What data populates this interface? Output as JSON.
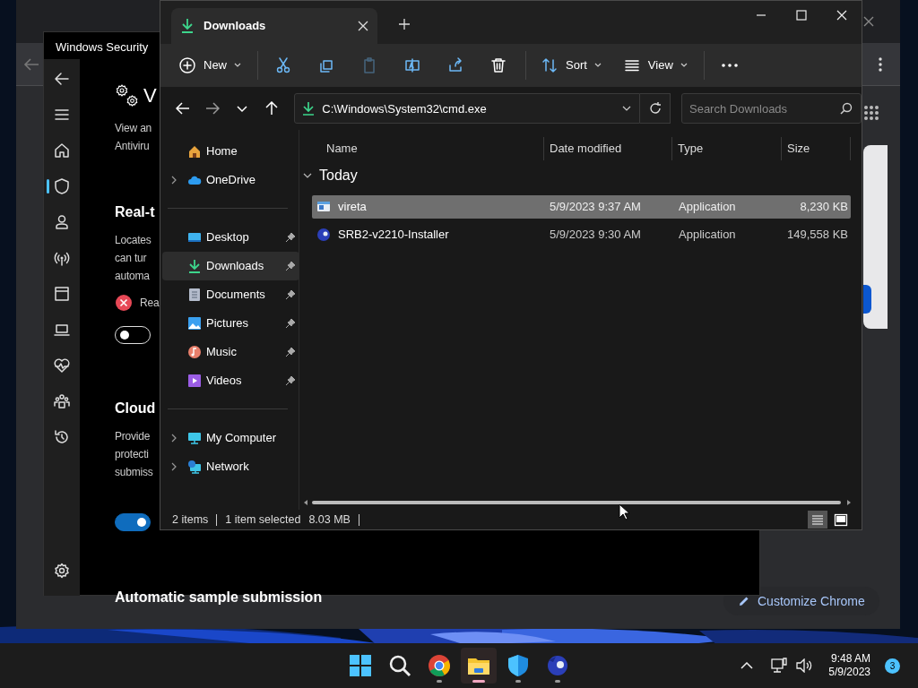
{
  "chrome_window": {
    "customize_button": "Customize Chrome"
  },
  "security_window": {
    "title": "Windows Security",
    "nav": [
      {
        "kind": "back",
        "selected": false
      },
      {
        "kind": "menu",
        "selected": false
      },
      {
        "kind": "home",
        "selected": false
      },
      {
        "kind": "shield",
        "selected": true
      },
      {
        "kind": "person",
        "selected": false
      },
      {
        "kind": "antenna",
        "selected": false
      },
      {
        "kind": "window",
        "selected": false
      },
      {
        "kind": "laptop",
        "selected": false
      },
      {
        "kind": "heart",
        "selected": false
      },
      {
        "kind": "family",
        "selected": false
      },
      {
        "kind": "history",
        "selected": false
      },
      {
        "kind": "settings",
        "selected": false
      }
    ],
    "heading": "V",
    "intro": [
      "View an",
      "Antiviru"
    ],
    "sections": [
      {
        "title": "Real-t",
        "description": [
          "Locates",
          "can tur",
          "automa"
        ],
        "status": {
          "kind": "error",
          "label": "Rea"
        },
        "toggle": {
          "on": false
        }
      },
      {
        "title": "Cloud",
        "description": [
          "Provide",
          "protecti",
          "submiss"
        ],
        "toggle": {
          "on": true
        }
      },
      {
        "title": "Automatic sample submission"
      }
    ]
  },
  "explorer_window": {
    "tabs": [
      {
        "label": "Downloads",
        "selected": true
      }
    ],
    "toolbar": [
      {
        "kind": "new",
        "label": "New",
        "disabled": false
      },
      {
        "kind": "cut",
        "disabled": false
      },
      {
        "kind": "copy",
        "disabled": false
      },
      {
        "kind": "paste",
        "disabled": true
      },
      {
        "kind": "rename",
        "disabled": false
      },
      {
        "kind": "share",
        "disabled": false
      },
      {
        "kind": "delete",
        "disabled": false
      },
      {
        "kind": "sort",
        "label": "Sort",
        "disabled": false
      },
      {
        "kind": "view",
        "label": "View",
        "disabled": false
      },
      {
        "kind": "more",
        "disabled": false
      }
    ],
    "address": "C:\\Windows\\System32\\cmd.exe",
    "search": {
      "placeholder": "Search Downloads"
    },
    "nav_pane": [
      [
        {
          "kind": "home",
          "label": "Home",
          "expandable": false,
          "pinned": false,
          "selected": false
        },
        {
          "kind": "cloud",
          "label": "OneDrive",
          "expandable": true,
          "pinned": false,
          "selected": false
        }
      ],
      [
        {
          "kind": "desktop",
          "label": "Desktop",
          "expandable": false,
          "pinned": true,
          "selected": false
        },
        {
          "kind": "downloads",
          "label": "Downloads",
          "expandable": false,
          "pinned": true,
          "selected": true
        },
        {
          "kind": "documents",
          "label": "Documents",
          "expandable": false,
          "pinned": true,
          "selected": false
        },
        {
          "kind": "pictures",
          "label": "Pictures",
          "expandable": false,
          "pinned": true,
          "selected": false
        },
        {
          "kind": "music",
          "label": "Music",
          "expandable": false,
          "pinned": true,
          "selected": false
        },
        {
          "kind": "videos",
          "label": "Videos",
          "expandable": false,
          "pinned": true,
          "selected": false
        }
      ],
      [
        {
          "kind": "computer",
          "label": "My Computer",
          "expandable": true,
          "pinned": false,
          "selected": false
        },
        {
          "kind": "network",
          "label": "Network",
          "expandable": true,
          "pinned": false,
          "selected": false
        }
      ]
    ],
    "columns": [
      "Name",
      "Date modified",
      "Type",
      "Size"
    ],
    "group": {
      "label": "Today",
      "expanded": true
    },
    "files": [
      {
        "kind": "app",
        "name": "vireta",
        "date": "5/9/2023 9:37 AM",
        "type": "Application",
        "size": "8,230 KB",
        "selected": true
      },
      {
        "kind": "game",
        "name": "SRB2-v2210-Installer",
        "date": "5/9/2023 9:30 AM",
        "type": "Application",
        "size": "149,558 KB",
        "selected": false
      }
    ],
    "status_bar": {
      "count": "2 items",
      "selection": "1 item selected",
      "size": "8.03 MB"
    },
    "view_modes": [
      {
        "kind": "details",
        "selected": true
      },
      {
        "kind": "tiles",
        "selected": false
      }
    ]
  },
  "taskbar": {
    "apps": [
      {
        "kind": "start",
        "running": false,
        "selected": false
      },
      {
        "kind": "search",
        "running": false,
        "selected": false
      },
      {
        "kind": "browser",
        "running": true,
        "selected": false
      },
      {
        "kind": "folder",
        "running": true,
        "selected": true
      },
      {
        "kind": "shield",
        "running": true,
        "selected": false
      },
      {
        "kind": "game",
        "running": true,
        "selected": false
      }
    ],
    "time": "9:48 AM",
    "date": "5/9/2023",
    "notifications": "3"
  }
}
